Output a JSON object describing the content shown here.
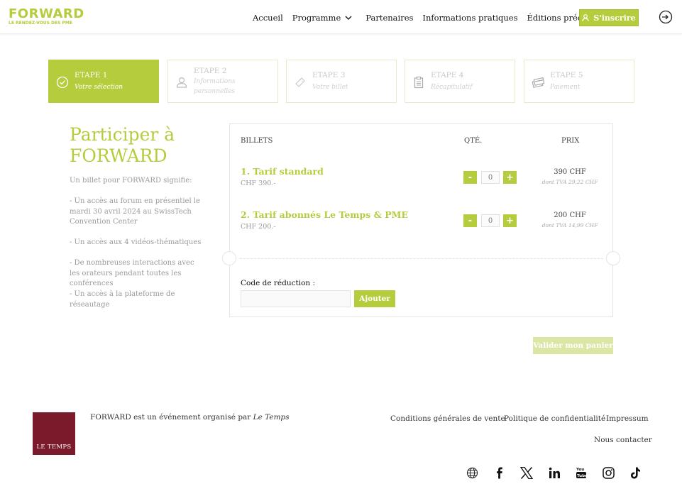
{
  "brand": {
    "name": "FORWARD",
    "tagline": "LE RENDEZ-VOUS DES PME",
    "color": "#b5cc3d"
  },
  "nav": {
    "items": [
      "Accueil",
      "Programme",
      "Partenaires",
      "Informations pratiques",
      "Éditions précédentes"
    ],
    "cta": "S'inscrire"
  },
  "steps": [
    {
      "title": "ETAPE 1",
      "sub": "Votre sélection",
      "icon": "check-circle-icon",
      "active": true
    },
    {
      "title": "ETAPE 2",
      "sub": "Informations personnelles",
      "icon": "user-icon",
      "active": false
    },
    {
      "title": "ETAPE 3",
      "sub": "Votre billet",
      "icon": "ticket-icon",
      "active": false
    },
    {
      "title": "ETAPE 4",
      "sub": "Récapitulatif",
      "icon": "clipboard-icon",
      "active": false
    },
    {
      "title": "ETAPE 5",
      "sub": "Paiement",
      "icon": "credit-card-icon",
      "active": false
    }
  ],
  "intro": {
    "title": "Participer à FORWARD",
    "paragraphs": [
      "Un billet pour FORWARD signifie:",
      "- Un accès au forum en présentiel le mardi 30 avril 2024 au SwissTech Convention Center",
      "- Un accès aux 4 vidéos-thématiques",
      "- De nombreuses interactions avec les orateurs pendant toutes les conférences",
      "- Un accès à la plateforme de réseautage"
    ]
  },
  "tickets": {
    "headers": {
      "billets": "BILLETS",
      "qte": "QTÉ.",
      "prix": "PRIX"
    },
    "items": [
      {
        "name": "1. Tarif standard",
        "sub": "CHF 390.-",
        "qty": "0",
        "price": "390 CHF",
        "tva": "dont TVA 29,22 CHF"
      },
      {
        "name": "2. Tarif abonnés Le Temps & PME",
        "sub": "CHF 200.-",
        "qty": "0",
        "price": "200 CHF",
        "tva": "dont TVA 14,99 CHF"
      }
    ],
    "minus": "-",
    "plus": "+",
    "code_label": "Code de réduction :",
    "code_value": "",
    "add_label": "Ajouter",
    "validate_label": "Valider mon panier"
  },
  "footer": {
    "logo_text": "LE TEMPS",
    "org_prefix": "FORWARD est un événement organisé par ",
    "org_name": "Le Temps",
    "links": [
      "Conditions générales de vente",
      "Politique de confidentialité",
      "Impressum",
      "Nous contacter"
    ],
    "social": [
      "globe-icon",
      "facebook-icon",
      "x-icon",
      "linkedin-icon",
      "youtube-icon",
      "instagram-icon",
      "tiktok-icon"
    ]
  }
}
